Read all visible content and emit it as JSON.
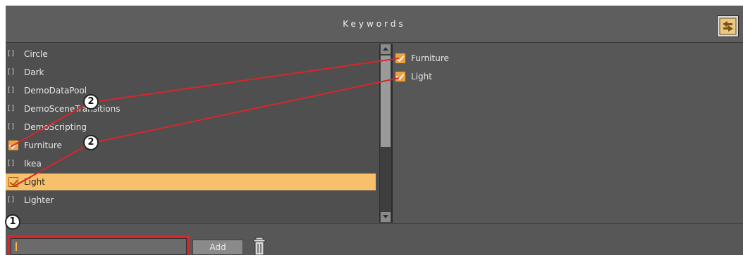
{
  "header": {
    "title": "Keywords",
    "refresh_icon": "sync-icon"
  },
  "left_list": {
    "items": [
      {
        "label": "Circle",
        "checked": false,
        "selected": false
      },
      {
        "label": "Dark",
        "checked": false,
        "selected": false
      },
      {
        "label": "DemoDataPool",
        "checked": false,
        "selected": false
      },
      {
        "label": "DemoSceneTransitions",
        "checked": false,
        "selected": false
      },
      {
        "label": "DemoScripting",
        "checked": false,
        "selected": false
      },
      {
        "label": "Furniture",
        "checked": true,
        "selected": false
      },
      {
        "label": "Ikea",
        "checked": false,
        "selected": false
      },
      {
        "label": "Light",
        "checked": true,
        "selected": true
      },
      {
        "label": "Lighter",
        "checked": false,
        "selected": false
      }
    ]
  },
  "right_list": {
    "items": [
      {
        "label": "Furniture",
        "checked": true
      },
      {
        "label": "Light",
        "checked": true
      }
    ]
  },
  "bottom": {
    "input_value": "",
    "add_label": "Add",
    "trash_icon": "trash-icon"
  },
  "callouts": [
    {
      "label": "1"
    },
    {
      "label": "2"
    },
    {
      "label": "2"
    }
  ],
  "colors": {
    "selection": "#f7c06a",
    "checkbox_checked": "#f0a23a",
    "callout_line": "#d8262b"
  }
}
